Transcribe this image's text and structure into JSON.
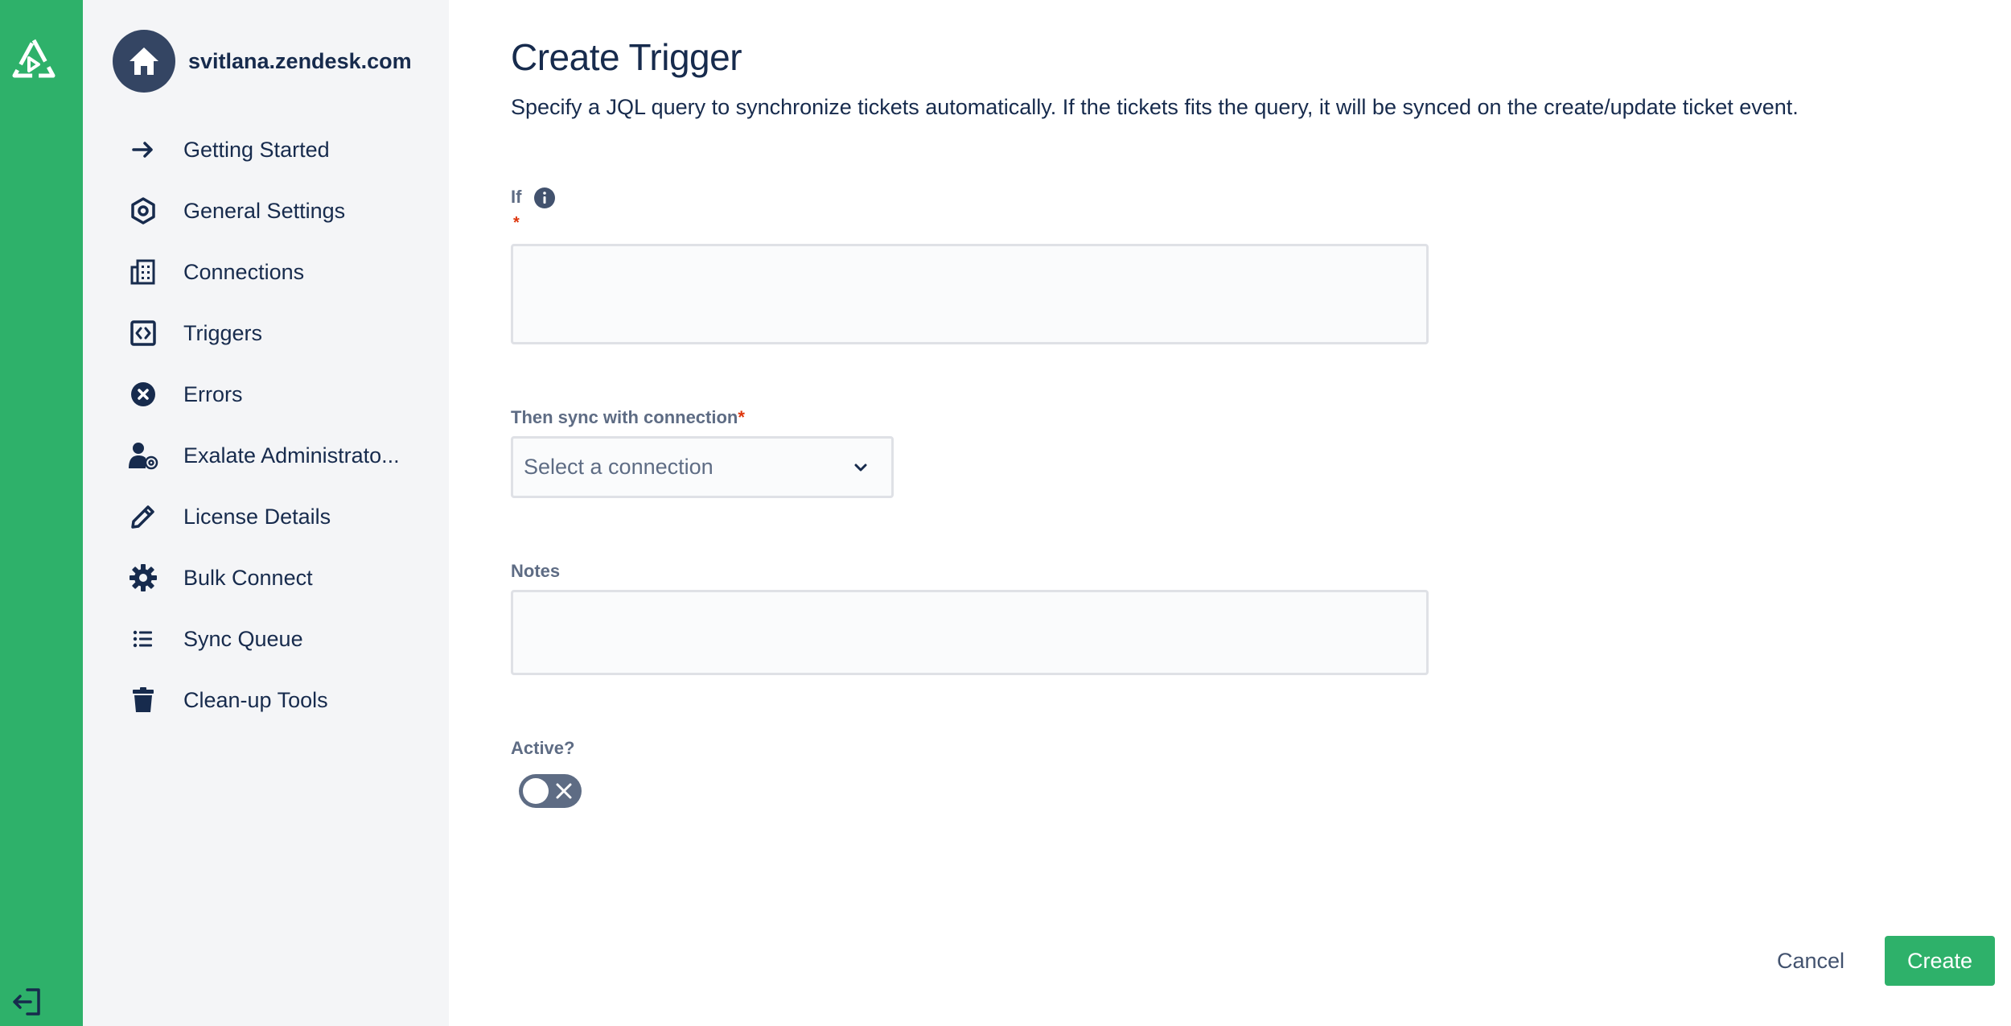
{
  "colors": {
    "brand_green": "#2eb16a",
    "sidebar_bg": "#f4f5f7",
    "text_primary": "#172b4d",
    "text_subtle": "#5e6c84",
    "required": "#de350b"
  },
  "rail": {
    "logo_icon": "exalate-logo-icon",
    "logout_icon": "logout-icon"
  },
  "sidebar": {
    "site_icon": "home-icon",
    "site_name": "svitlana.zendesk.com",
    "items": [
      {
        "label": "Getting Started",
        "icon": "arrow-right-icon"
      },
      {
        "label": "General Settings",
        "icon": "hexagon-settings-icon"
      },
      {
        "label": "Connections",
        "icon": "building-icon"
      },
      {
        "label": "Triggers",
        "icon": "code-brackets-icon"
      },
      {
        "label": "Errors",
        "icon": "error-x-circle-icon"
      },
      {
        "label": "Exalate Administrato...",
        "icon": "user-at-icon"
      },
      {
        "label": "License Details",
        "icon": "pencil-icon"
      },
      {
        "label": "Bulk Connect",
        "icon": "gear-icon"
      },
      {
        "label": "Sync Queue",
        "icon": "list-icon"
      },
      {
        "label": "Clean-up Tools",
        "icon": "trash-icon"
      }
    ]
  },
  "form": {
    "title": "Create Trigger",
    "description": "Specify a JQL query to synchronize tickets automatically. If the tickets fits the query, it will be synced on the create/update ticket event.",
    "if_label": "If",
    "if_value": "",
    "required_mark": "*",
    "connection_label": "Then sync with connection",
    "connection_placeholder": "Select a connection",
    "notes_label": "Notes",
    "notes_value": "",
    "active_label": "Active?",
    "active": false
  },
  "actions": {
    "cancel": "Cancel",
    "create": "Create"
  }
}
